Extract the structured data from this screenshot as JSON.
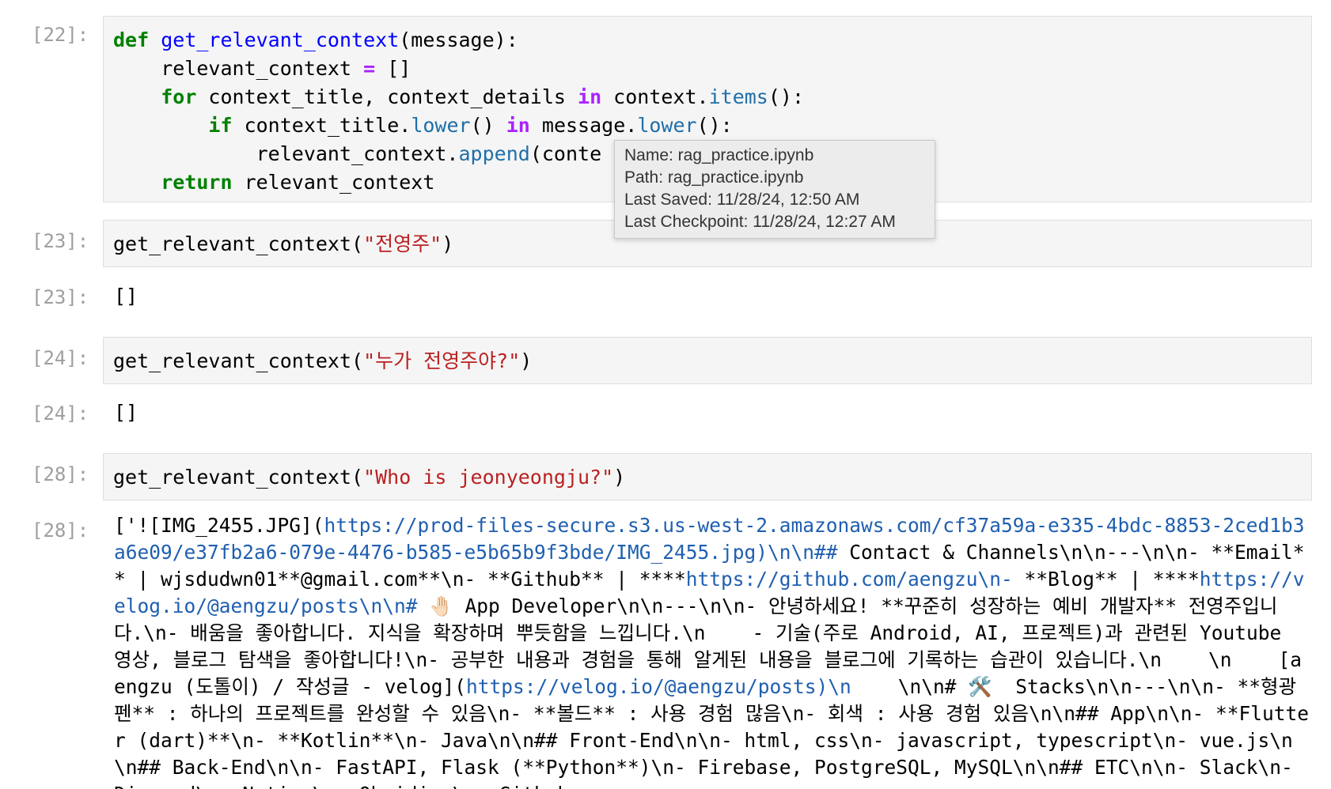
{
  "cells": [
    {
      "prompt": "[22]:",
      "code_lines": [
        [
          {
            "t": "def",
            "c": "kw"
          },
          {
            "t": " ",
            "c": "plain"
          },
          {
            "t": "get_relevant_context",
            "c": "fn"
          },
          {
            "t": "(message):",
            "c": "plain"
          }
        ],
        [
          {
            "t": "    relevant_context ",
            "c": "plain"
          },
          {
            "t": "=",
            "c": "op"
          },
          {
            "t": " []",
            "c": "plain"
          }
        ],
        [
          {
            "t": "    ",
            "c": "plain"
          },
          {
            "t": "for",
            "c": "kw"
          },
          {
            "t": " context_title, context_details ",
            "c": "plain"
          },
          {
            "t": "in",
            "c": "op"
          },
          {
            "t": " context.",
            "c": "plain"
          },
          {
            "t": "items",
            "c": "mth"
          },
          {
            "t": "():",
            "c": "plain"
          }
        ],
        [
          {
            "t": "        ",
            "c": "plain"
          },
          {
            "t": "if",
            "c": "kw"
          },
          {
            "t": " context_title.",
            "c": "plain"
          },
          {
            "t": "lower",
            "c": "mth"
          },
          {
            "t": "() ",
            "c": "plain"
          },
          {
            "t": "in",
            "c": "op"
          },
          {
            "t": " message.",
            "c": "plain"
          },
          {
            "t": "lower",
            "c": "mth"
          },
          {
            "t": "():",
            "c": "plain"
          }
        ],
        [
          {
            "t": "            relevant_context.",
            "c": "plain"
          },
          {
            "t": "append",
            "c": "mth"
          },
          {
            "t": "(conte",
            "c": "plain"
          }
        ],
        [
          {
            "t": "    ",
            "c": "plain"
          },
          {
            "t": "return",
            "c": "kw"
          },
          {
            "t": " relevant_context",
            "c": "plain"
          }
        ]
      ]
    },
    {
      "prompt": "[23]:",
      "code_lines": [
        [
          {
            "t": "get_relevant_context(",
            "c": "plain"
          },
          {
            "t": "\"전영주\"",
            "c": "str"
          },
          {
            "t": ")",
            "c": "plain"
          }
        ]
      ],
      "output_prompt": "[23]:",
      "output": "[]"
    },
    {
      "prompt": "[24]:",
      "code_lines": [
        [
          {
            "t": "get_relevant_context(",
            "c": "plain"
          },
          {
            "t": "\"누가 전영주야?\"",
            "c": "str"
          },
          {
            "t": ")",
            "c": "plain"
          }
        ]
      ],
      "output_prompt": "[24]:",
      "output": "[]"
    },
    {
      "prompt": "[28]:",
      "code_lines": [
        [
          {
            "t": "get_relevant_context(",
            "c": "plain"
          },
          {
            "t": "\"Who is jeonyeongju?\"",
            "c": "str"
          },
          {
            "t": ")",
            "c": "plain"
          }
        ]
      ],
      "output_prompt": "[28]:"
    }
  ],
  "long_output_segments": [
    {
      "t": "['![IMG_2455.JPG](",
      "c": "plain"
    },
    {
      "t": "https://prod-files-secure.s3.us-west-2.amazonaws.com/cf37a59a-e335-4bdc-8853-2ced1b3a6e09/e37fb2a6-079e-4476-b585-e5b65b9f3bde/IMG_2455.jpg)\\n\\n##",
      "c": "link"
    },
    {
      "t": " Contact & Channels\\n\\n---\\n\\n- **Email** | wjsdudwn01**@gmail.com**\\n- **Github** | ****",
      "c": "plain"
    },
    {
      "t": "https://github.com/aengzu\\n-",
      "c": "link"
    },
    {
      "t": " **Blog** | ****",
      "c": "plain"
    },
    {
      "t": "https://velog.io/@aengzu/posts\\n\\n#",
      "c": "link"
    },
    {
      "t": " 🤚🏻 App Developer\\n\\n---\\n\\n- 안녕하세요! **꾸준히 성장하는 예비 개발자** 전영주입니다.\\n- 배움을 좋아합니다. 지식을 확장하며 뿌듯함을 느낍니다.\\n    - 기술(주로 Android, AI, 프로젝트)과 관련된 Youtube 영상, 블로그 탐색을 좋아합니다!\\n- 공부한 내용과 경험을 통해 알게된 내용을 블로그에 기록하는 습관이 있습니다.\\n    \\n    [aengzu (도톨이) / 작성글 - velog](",
      "c": "plain"
    },
    {
      "t": "https://velog.io/@aengzu/posts)\\n",
      "c": "link"
    },
    {
      "t": "    \\n\\n# 🛠️  Stacks\\n\\n---\\n\\n- **형광펜** : 하나의 프로젝트를 완성할 수 있음\\n- **볼드** : 사용 경험 많음\\n- 회색 : 사용 경험 있음\\n\\n## App\\n\\n- **Flutter (dart)**\\n- **Kotlin**\\n- Java\\n\\n## Front-End\\n\\n- html, css\\n- javascript, typescript\\n- vue.js\\n\\n## Back-End\\n\\n- FastAPI, Flask (**Python**)\\n- Firebase, PostgreSQL, MySQL\\n\\n## ETC\\n\\n- Slack\\n- Discord\\n- Notion\\n- Obsidian\\n- Github",
      "c": "plain"
    }
  ],
  "tooltip": {
    "name": "Name: rag_practice.ipynb",
    "path": "Path: rag_practice.ipynb",
    "last_saved": "Last Saved: 11/28/24, 12:50 AM",
    "last_checkpoint": "Last Checkpoint: 11/28/24, 12:27 AM"
  }
}
